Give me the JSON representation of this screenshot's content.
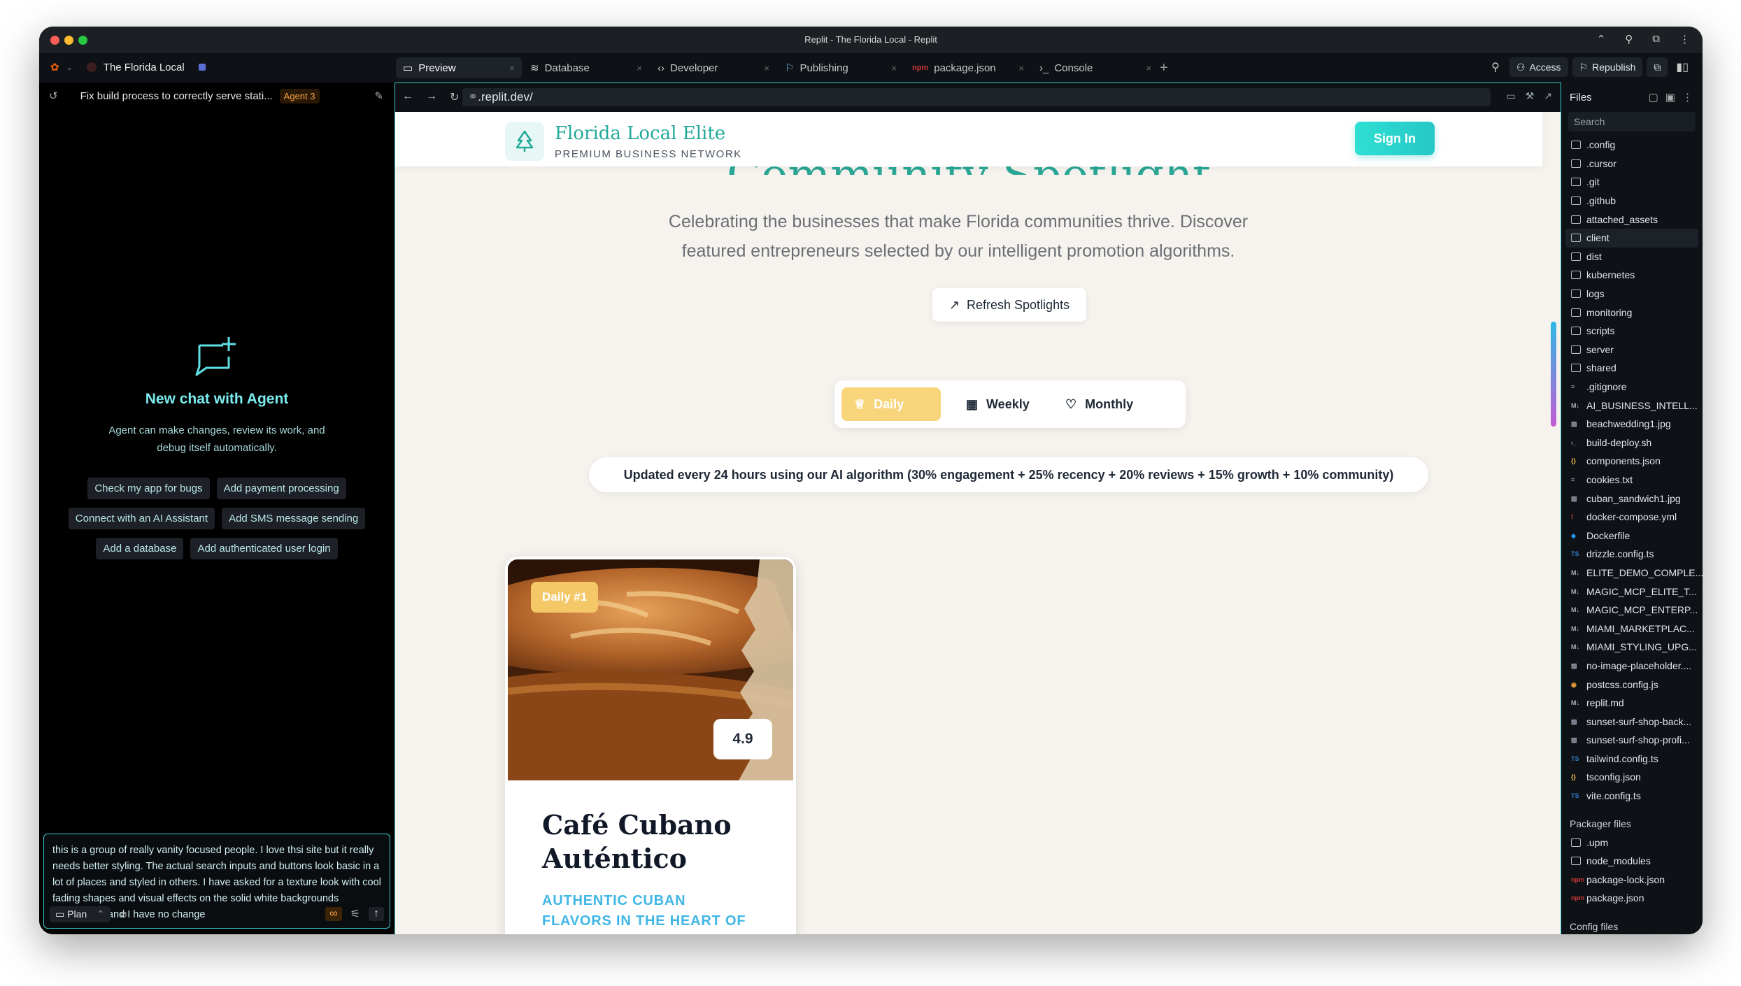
{
  "window": {
    "title": "Replit - The Florida Local - Replit"
  },
  "project": {
    "name": "The Florida Local"
  },
  "tabs": [
    {
      "label": "Preview",
      "icon": "monitor-icon"
    },
    {
      "label": "Database",
      "icon": "database-icon"
    },
    {
      "label": "Developer",
      "icon": "code-icon"
    },
    {
      "label": "Publishing",
      "icon": "publish-icon"
    },
    {
      "label": "package.json",
      "icon": "npm-icon"
    },
    {
      "label": "Console",
      "icon": "terminal-icon"
    }
  ],
  "topbar": {
    "access": "Access",
    "republish": "Republish"
  },
  "agent": {
    "thread_title": "Fix build process to correctly serve stati...",
    "badge": "Agent 3",
    "new_chat_title": "New chat with Agent",
    "new_chat_desc_1": "Agent can make changes, review its work, and",
    "new_chat_desc_2": "debug itself automatically.",
    "suggestions": [
      [
        "Check my app for bugs",
        "Add payment processing"
      ],
      [
        "Connect with an AI Assistant",
        "Add SMS message sending"
      ],
      [
        "Add a database",
        "Add authenticated user login"
      ]
    ],
    "composer_text": "this is a group of really vanity focused people. I love thsi site but it really needs better styling. The actual search inputs and buttons look basic in a lot of places and styled in others.  I have asked for a texture look with cool fading shapes and visual effects on the solid white backgrounds everywhere and I have no change",
    "mode": "Plan"
  },
  "browser": {
    "url": ".replit.dev/"
  },
  "site": {
    "brand": "Florida Local Elite",
    "brand_sub": "PREMIUM BUSINESS NETWORK",
    "sign_in": "Sign In",
    "headline": "Community Spotlight",
    "lead": "Celebrating the businesses that make Florida communities thrive. Discover featured entrepreneurs selected by our intelligent promotion algorithms.",
    "refresh": "Refresh Spotlights",
    "periods": {
      "daily": "Daily",
      "weekly": "Weekly",
      "monthly": "Monthly"
    },
    "algo_note": "Updated every 24 hours using our AI algorithm (30% engagement + 25% recency + 20% reviews + 15% growth + 10% community)",
    "card": {
      "rank": "Daily #1",
      "rating": "4.9",
      "name": "Café Cubano Auténtico",
      "tagline": "AUTHENTIC CUBAN FLAVORS IN THE HEART OF MIAMI"
    }
  },
  "files": {
    "title": "Files",
    "search_placeholder": "Search",
    "items": [
      {
        "name": ".config",
        "type": "folder"
      },
      {
        "name": ".cursor",
        "type": "folder"
      },
      {
        "name": ".git",
        "type": "folder"
      },
      {
        "name": ".github",
        "type": "folder"
      },
      {
        "name": "attached_assets",
        "type": "folder"
      },
      {
        "name": "client",
        "type": "folder",
        "selected": true
      },
      {
        "name": "dist",
        "type": "folder"
      },
      {
        "name": "kubernetes",
        "type": "folder"
      },
      {
        "name": "logs",
        "type": "folder"
      },
      {
        "name": "monitoring",
        "type": "folder"
      },
      {
        "name": "scripts",
        "type": "folder"
      },
      {
        "name": "server",
        "type": "folder"
      },
      {
        "name": "shared",
        "type": "folder"
      },
      {
        "name": ".gitignore",
        "type": "text"
      },
      {
        "name": "AI_BUSINESS_INTELL...",
        "type": "md"
      },
      {
        "name": "beachwedding1.jpg",
        "type": "image"
      },
      {
        "name": "build-deploy.sh",
        "type": "shell"
      },
      {
        "name": "components.json",
        "type": "json"
      },
      {
        "name": "cookies.txt",
        "type": "text"
      },
      {
        "name": "cuban_sandwich1.jpg",
        "type": "image"
      },
      {
        "name": "docker-compose.yml",
        "type": "yaml"
      },
      {
        "name": "Dockerfile",
        "type": "docker"
      },
      {
        "name": "drizzle.config.ts",
        "type": "ts"
      },
      {
        "name": "ELITE_DEMO_COMPLE...",
        "type": "md"
      },
      {
        "name": "MAGIC_MCP_ELITE_T...",
        "type": "md"
      },
      {
        "name": "MAGIC_MCP_ENTERP...",
        "type": "md"
      },
      {
        "name": "MIAMI_MARKETPLAC...",
        "type": "md"
      },
      {
        "name": "MIAMI_STYLING_UPG...",
        "type": "md"
      },
      {
        "name": "no-image-placeholder....",
        "type": "image"
      },
      {
        "name": "postcss.config.js",
        "type": "js"
      },
      {
        "name": "replit.md",
        "type": "md"
      },
      {
        "name": "sunset-surf-shop-back...",
        "type": "image"
      },
      {
        "name": "sunset-surf-shop-profi...",
        "type": "image"
      },
      {
        "name": "tailwind.config.ts",
        "type": "ts"
      },
      {
        "name": "tsconfig.json",
        "type": "json"
      },
      {
        "name": "vite.config.ts",
        "type": "ts"
      }
    ],
    "packager_title": "Packager files",
    "packager": [
      {
        "name": ".upm",
        "type": "folder"
      },
      {
        "name": "node_modules",
        "type": "folder"
      },
      {
        "name": "package-lock.json",
        "type": "npm"
      },
      {
        "name": "package.json",
        "type": "npm"
      }
    ],
    "config_title": "Config files"
  },
  "colors": {
    "accent": "#37c9cf",
    "brand": "#22a99a",
    "gold": "#f4c867",
    "tagline": "#3fb7e6"
  }
}
